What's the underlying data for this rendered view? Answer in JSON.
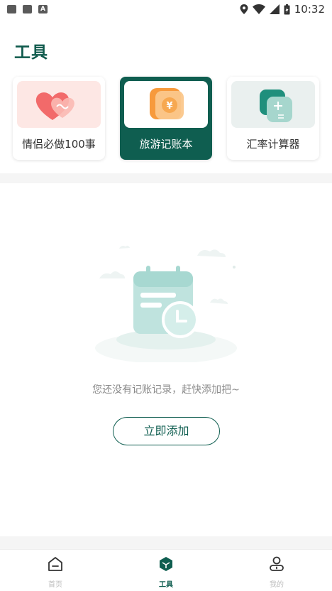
{
  "status_bar": {
    "time": "10:32"
  },
  "page": {
    "title": "工具"
  },
  "tools": [
    {
      "label": "情侣必做100事",
      "icon": "hearts-icon",
      "active": false
    },
    {
      "label": "旅游记账本",
      "icon": "yen-coin-icon",
      "active": true
    },
    {
      "label": "汇率计算器",
      "icon": "calculator-icon",
      "active": false
    }
  ],
  "empty_state": {
    "message": "您还没有记账记录，赶快添加把~",
    "add_button_label": "立即添加",
    "illustration": "calendar-clock-icon"
  },
  "bottom_nav": [
    {
      "label": "首页",
      "icon": "home-icon",
      "active": false
    },
    {
      "label": "工具",
      "icon": "tools-cube-icon",
      "active": true
    },
    {
      "label": "我的",
      "icon": "profile-icon",
      "active": false
    }
  ],
  "colors": {
    "brand": "#0f5e50",
    "muted_text": "#8a8a8a",
    "card_pink": "#fde7e4",
    "card_mint": "#eaf0ef"
  }
}
